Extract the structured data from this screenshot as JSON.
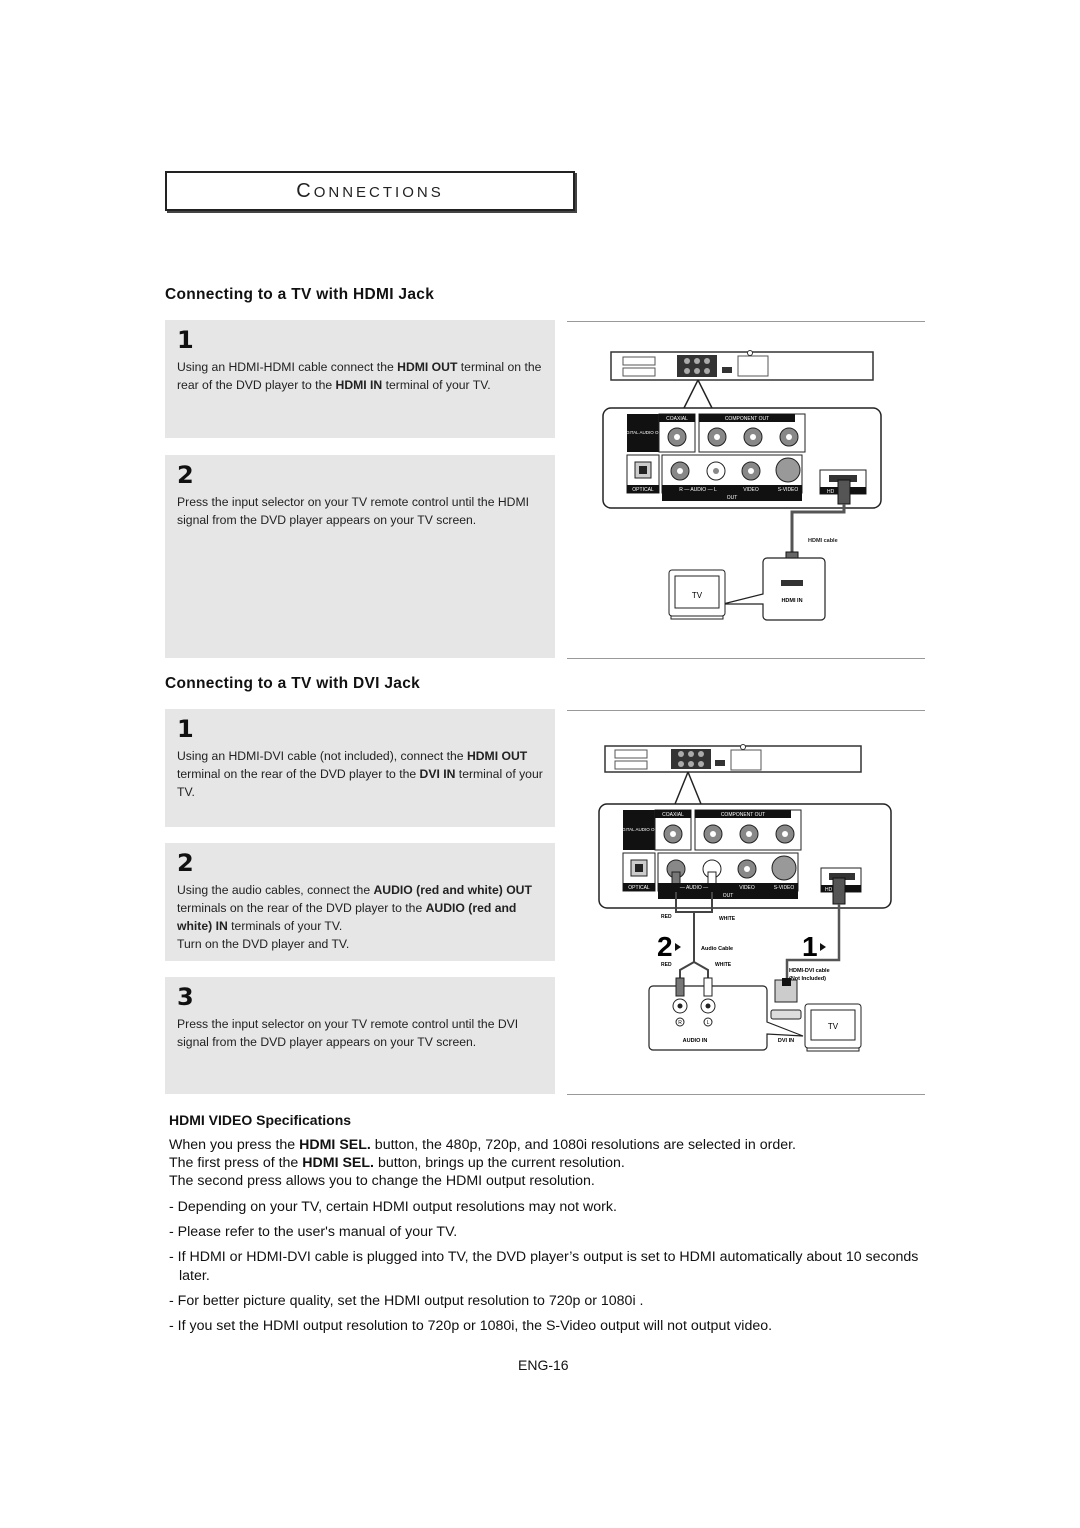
{
  "section": {
    "title_first": "C",
    "title_rest": "ONNECTIONS"
  },
  "hdmi": {
    "heading": "Connecting to a TV with HDMI Jack",
    "steps": [
      {
        "num": "1",
        "parts": [
          "Using an HDMI-HDMI cable connect the ",
          "HDMI OUT",
          " terminal on the rear of the DVD player to the ",
          "HDMI IN",
          " terminal of your TV."
        ]
      },
      {
        "num": "2",
        "text": "Press the input selector on your TV remote control until the HDMI signal from the DVD player appears on your TV screen."
      }
    ],
    "diagram": {
      "panel_labels": {
        "coaxial": "COAXIAL",
        "component_out": "COMPONENT OUT",
        "digital_audio_out": "DIGITAL AUDIO OUT",
        "optical": "OPTICAL",
        "audio": "R — AUDIO — L",
        "video": "VIDEO",
        "svideo": "S-VIDEO",
        "out": "OUT",
        "hdmi_out": "HDMI OUT"
      },
      "cable_label": "HDMI cable",
      "tv_label": "TV",
      "hdmi_in_label": "HDMI IN"
    }
  },
  "dvi": {
    "heading": "Connecting to a TV with DVI Jack",
    "steps": [
      {
        "num": "1",
        "parts": [
          "Using an HDMI-DVI cable (not included), connect the ",
          "HDMI OUT",
          " terminal on the rear of the DVD player to the ",
          "DVI IN",
          " terminal of your TV."
        ]
      },
      {
        "num": "2",
        "parts": [
          "Using the audio cables, connect the ",
          "AUDIO (red and white) OUT",
          " terminals on the rear of the DVD player to the ",
          "AUDIO (red and white) IN",
          " terminals of your TV."
        ],
        "extra": "Turn on the DVD player and TV."
      },
      {
        "num": "3",
        "text": "Press the input selector on your TV remote control until the DVI signal from the DVD player appears on your TV screen."
      }
    ],
    "diagram": {
      "red": "RED",
      "white": "WHITE",
      "audio_cable": "Audio Cable",
      "hdmi_dvi_cable": "HDMI-DVI cable",
      "not_included": "(Not Included)",
      "audio_in": "AUDIO IN",
      "dvi_in": "DVI IN",
      "tv_label": "TV",
      "callout_2": "2",
      "callout_1": "1",
      "r": "R",
      "l": "L"
    }
  },
  "specs": {
    "title": "HDMI VIDEO Specifications",
    "p1": [
      "When you press the ",
      "HDMI SEL.",
      " button, the 480p, 720p, and 1080i resolutions are selected in order."
    ],
    "p2": [
      "The first press of the ",
      "HDMI SEL.",
      " button, brings up the current resolution."
    ],
    "p3": "The second press allows you to change the HDMI output resolution.",
    "bullets": [
      "- Depending on your TV, certain HDMI output resolutions may not work.",
      "- Please refer to the user's manual of your TV.",
      "- If HDMI or HDMI-DVI cable is plugged into TV, the DVD player’s output is set to HDMI automatically about 10 seconds later.",
      "- For better picture quality, set the HDMI output resolution to 720p or 1080i .",
      "- If you set the HDMI output resolution to 720p or 1080i, the S-Video output will not output video."
    ]
  },
  "footer": {
    "page": "ENG-16"
  }
}
